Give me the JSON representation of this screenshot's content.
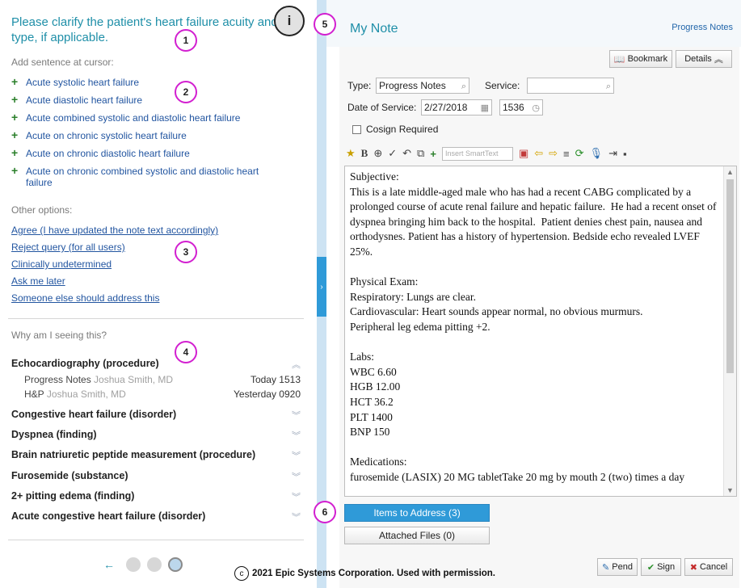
{
  "query": {
    "title": "Please clarify the patient's heart failure acuity and type, if applicable.",
    "add_sentence_label": "Add sentence at cursor:",
    "options": [
      "Acute systolic heart failure",
      "Acute diastolic heart failure",
      "Acute combined systolic and diastolic heart failure",
      "Acute on chronic systolic heart failure",
      "Acute on chronic diastolic heart failure",
      "Acute on chronic combined systolic and diastolic heart failure"
    ],
    "other_options_label": "Other options:",
    "other_options": [
      "Agree (I have updated the note text accordingly)",
      "Reject query (for all users)",
      "Clinically undetermined",
      "Ask me later",
      "Someone else should address this"
    ],
    "why_label": "Why am I seeing this?",
    "findings": [
      {
        "name": "Echocardiography (procedure)",
        "expanded": true
      },
      {
        "name": "Congestive heart failure (disorder)",
        "expanded": false
      },
      {
        "name": "Dyspnea (finding)",
        "expanded": false
      },
      {
        "name": "Brain natriuretic peptide measurement (procedure)",
        "expanded": false
      },
      {
        "name": "Furosemide (substance)",
        "expanded": false
      },
      {
        "name": "2+ pitting edema (finding)",
        "expanded": false
      },
      {
        "name": "Acute congestive heart failure (disorder)",
        "expanded": false
      }
    ],
    "sources": [
      {
        "doc": "Progress Notes",
        "author": "Joshua Smith, MD",
        "when": "Today 1513"
      },
      {
        "doc": "H&P",
        "author": "Joshua Smith, MD",
        "when": "Yesterday 0920"
      }
    ],
    "pager": {
      "prev": "←",
      "pages": 3,
      "current_page": 3
    }
  },
  "note": {
    "title": "My Note",
    "top_link": "Progress Notes",
    "bookmark_label": "Bookmark",
    "details_label": "Details",
    "type_label": "Type:",
    "type_value": "Progress Notes",
    "service_label": "Service:",
    "service_value": "",
    "date_label": "Date of Service:",
    "date_value": "2/27/2018",
    "time_value": "1536",
    "cosign_label": "Cosign Required",
    "cosign_checked": false,
    "smarttext_placeholder": "Insert SmartText",
    "body": "Subjective:\nThis is a late middle-aged male who has had a recent CABG complicated by a prolonged course of acute renal failure and hepatic failure.  He had a recent onset of dyspnea bringing him back to the hospital.  Patient denies chest pain, nausea and orthodysnes. Patient has a history of hypertension. Bedside echo revealed LVEF 25%.\n\nPhysical Exam:\nRespiratory: Lungs are clear.\nCardiovascular: Heart sounds appear normal, no obvious murmurs.\nPeripheral leg edema pitting +2.\n\nLabs:\nWBC 6.60\nHGB 12.00\nHCT 36.2\nPLT 1400\nBNP 150\n\nMedications:\nfurosemide (LASIX) 20 MG tabletTake 20 mg by mouth 2 (two) times a day",
    "items_to_address": "Items to Address (3)",
    "attached_files": "Attached Files (0)",
    "pend_label": "Pend",
    "sign_label": "Sign",
    "cancel_label": "Cancel"
  },
  "callouts": [
    "1",
    "2",
    "3",
    "4",
    "5",
    "6"
  ],
  "info_badge": "i",
  "copyright": "2021 Epic Systems Corporation. Used with permission.",
  "copyright_symbol": "c",
  "colors": {
    "accent": "#1f8fa8",
    "link": "#2255a0",
    "button_blue": "#2f9ad8",
    "callout": "#d21fd0",
    "add_plus": "#2a7f2a"
  }
}
